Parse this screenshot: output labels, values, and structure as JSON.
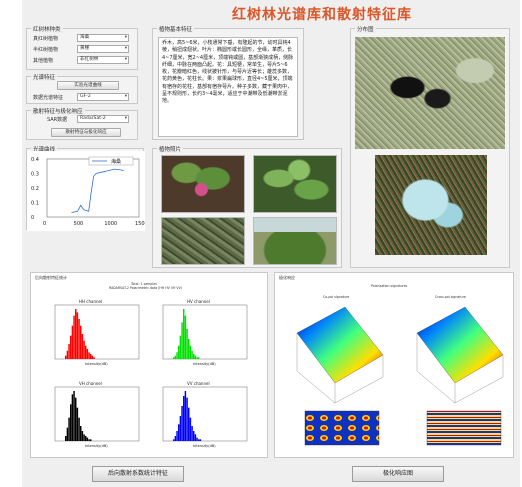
{
  "app": {
    "title": "红树林光谱库和散射特征库"
  },
  "species_panel": {
    "title": "红树林种类",
    "rows": [
      {
        "label": "真红树植物",
        "value": "海桑"
      },
      {
        "label": "半红树植物",
        "value": "黄槿"
      },
      {
        "label": "其他植物",
        "value": "非红树林"
      }
    ]
  },
  "spectral_panel": {
    "title": "光谱特征",
    "button": "实验光谱曲线",
    "data_label": "数据光谱特征",
    "data_value": "GF-2"
  },
  "scatter_panel": {
    "title": "散射特征与极化响应",
    "sar_label": "SAR数据",
    "sar_value": "RadarSat-2",
    "button": "散射特征与极化响应"
  },
  "curve_panel": {
    "title": "光谱曲线",
    "legend": "海桑",
    "chart_data": {
      "type": "line",
      "x_ticks": [
        "0",
        "500",
        "1000",
        "1500"
      ],
      "y_ticks": [
        "0",
        "0.1",
        "0.2",
        "0.3",
        "0.4"
      ],
      "xlim": [
        0,
        1500
      ],
      "ylim": [
        0,
        0.4
      ],
      "series": [
        {
          "name": "海桑",
          "x": [
            400,
            500,
            550,
            600,
            680,
            720,
            760,
            800,
            900,
            1000,
            1100,
            1200,
            1250
          ],
          "y": [
            0.03,
            0.04,
            0.08,
            0.05,
            0.04,
            0.17,
            0.28,
            0.3,
            0.31,
            0.32,
            0.33,
            0.325,
            0.32
          ]
        }
      ]
    }
  },
  "description_panel": {
    "title": "植物基本特征",
    "text": "乔木，高5~6米，小枝通常下垂，有隆起的节，幼时具钝4棱，稍扭成翅状。叶片：椭圆形或长圆形，全缘，革质，长4~7厘米，宽2~4厘米，顶端钝或圆，基部渐狭成柄，侧脉纤细，中脉在两面凸起。花：具短梗，常单生，萼片5~6枚，花瓣暗红色，线状披针形，与萼片近等长；雄蕊多数，花药黄色，花柱长。果：浆果扁球形，直径4~5厘米，顶端有宿存的花柱，基部有宿存萼片。种子多数，藏于果肉中，呈不规则形，长约3~4毫米，适应于中潮带及低潮带淤泥地。"
  },
  "photos_panel": {
    "title": "植物照片"
  },
  "map_panel": {
    "title": "分布图"
  },
  "histogram_panel": {
    "title": "后向散射特征统计",
    "figure_title": "Total: 1 samples",
    "figure_subtitle": "RADARSAT-2 Polarimetric data (HH HV VH VV)",
    "plots": [
      {
        "title": "HH channel",
        "color": "#ff0000",
        "xlabel": "Intensity(dB)"
      },
      {
        "title": "HV channel",
        "color": "#00e000",
        "xlabel": "Intensity(dB)"
      },
      {
        "title": "VH channel",
        "color": "#000000",
        "xlabel": "Intensity(dB)"
      },
      {
        "title": "VV channel",
        "color": "#0000ff",
        "xlabel": "Intensity(dB)"
      }
    ]
  },
  "polar_panel": {
    "title": "极化响应",
    "figure_title": "Polarization signatures",
    "plots": [
      {
        "title": "Co-pol signature"
      },
      {
        "title": "Cross-pol signature"
      }
    ]
  },
  "footer": {
    "left_button": "后向散射系数统计特征",
    "right_button": "极化响应图"
  },
  "colors": {
    "title": "#d9572a",
    "accent_blue": "#0000ff",
    "accent_red": "#ff0000",
    "accent_green": "#00e000"
  }
}
